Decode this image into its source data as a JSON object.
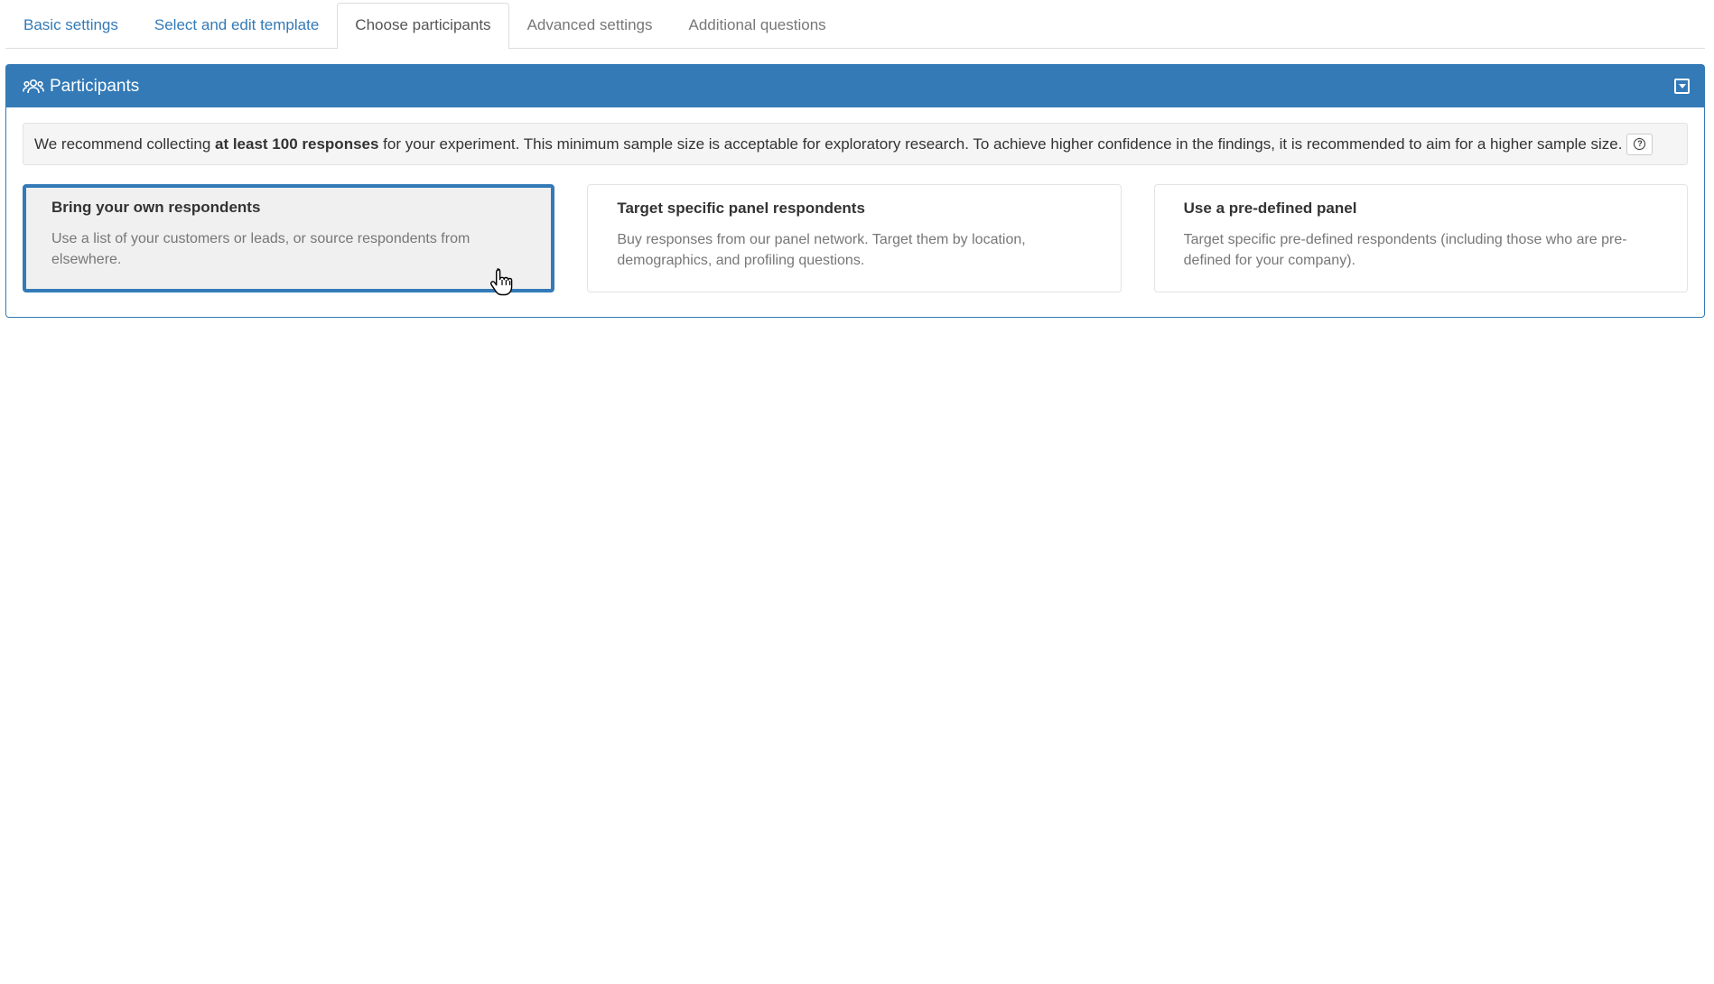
{
  "tabs": [
    {
      "label": "Basic settings",
      "state": "link"
    },
    {
      "label": "Select and edit template",
      "state": "link"
    },
    {
      "label": "Choose participants",
      "state": "active"
    },
    {
      "label": "Advanced settings",
      "state": "muted"
    },
    {
      "label": "Additional questions",
      "state": "muted"
    }
  ],
  "panel": {
    "title": "Participants",
    "notice": {
      "prefix": "We recommend collecting ",
      "bold": "at least 100 responses",
      "suffix": " for your experiment. This minimum sample size is acceptable for exploratory research. To achieve higher confidence in the findings, it is recommended to aim for a higher sample size."
    },
    "options": [
      {
        "title": "Bring your own respondents",
        "description": "Use a list of your customers or leads, or source respondents from elsewhere.",
        "selected": true
      },
      {
        "title": "Target specific panel respondents",
        "description": "Buy responses from our panel network. Target them by location, demographics, and profiling questions.",
        "selected": false
      },
      {
        "title": "Use a pre-defined panel",
        "description": "Target specific pre-defined respondents (including those who are pre-defined for your company).",
        "selected": false
      }
    ]
  },
  "colors": {
    "primary": "#337ab7",
    "selected_bg": "#f0f0f0",
    "muted_text": "#777777"
  },
  "icons": {
    "panel": "users-icon",
    "collapse": "collapse-icon",
    "help": "question-circle-icon",
    "cursor": "hand-pointer-cursor"
  }
}
